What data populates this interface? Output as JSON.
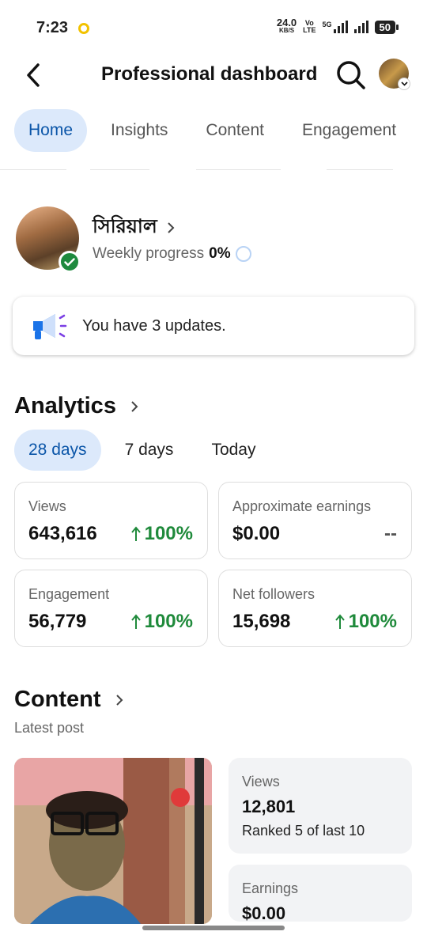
{
  "status_bar": {
    "time": "7:23",
    "net_speed": "24.0",
    "net_unit": "KB/S",
    "volte_top": "Vo",
    "volte_bottom": "LTE",
    "network": "5G",
    "battery": "50"
  },
  "header": {
    "title": "Professional dashboard",
    "back_icon": "back-arrow-icon",
    "search_icon": "search-icon"
  },
  "tabs": [
    {
      "label": "Home",
      "active": true
    },
    {
      "label": "Insights",
      "active": false
    },
    {
      "label": "Content",
      "active": false
    },
    {
      "label": "Engagement",
      "active": false
    }
  ],
  "profile": {
    "name": "সিরিয়াল",
    "progress_label": "Weekly progress",
    "progress_value": "0%"
  },
  "updates": {
    "text": "You have 3 updates."
  },
  "analytics": {
    "title": "Analytics",
    "ranges": [
      {
        "label": "28 days",
        "active": true
      },
      {
        "label": "7 days",
        "active": false
      },
      {
        "label": "Today",
        "active": false
      }
    ],
    "metrics": [
      {
        "label": "Views",
        "value": "643,616",
        "change": "100%"
      },
      {
        "label": "Approximate earnings",
        "value": "$0.00",
        "change": "--"
      },
      {
        "label": "Engagement",
        "value": "56,779",
        "change": "100%"
      },
      {
        "label": "Net followers",
        "value": "15,698",
        "change": "100%"
      }
    ]
  },
  "content": {
    "title": "Content",
    "subtitle": "Latest post",
    "stats": [
      {
        "label": "Views",
        "value": "12,801",
        "note": "Ranked 5 of last 10"
      },
      {
        "label": "Earnings",
        "value": "$0.00"
      }
    ]
  },
  "colors": {
    "accent": "#0a55a8",
    "accent_bg": "#dce9fb",
    "positive": "#1f8a3b"
  }
}
